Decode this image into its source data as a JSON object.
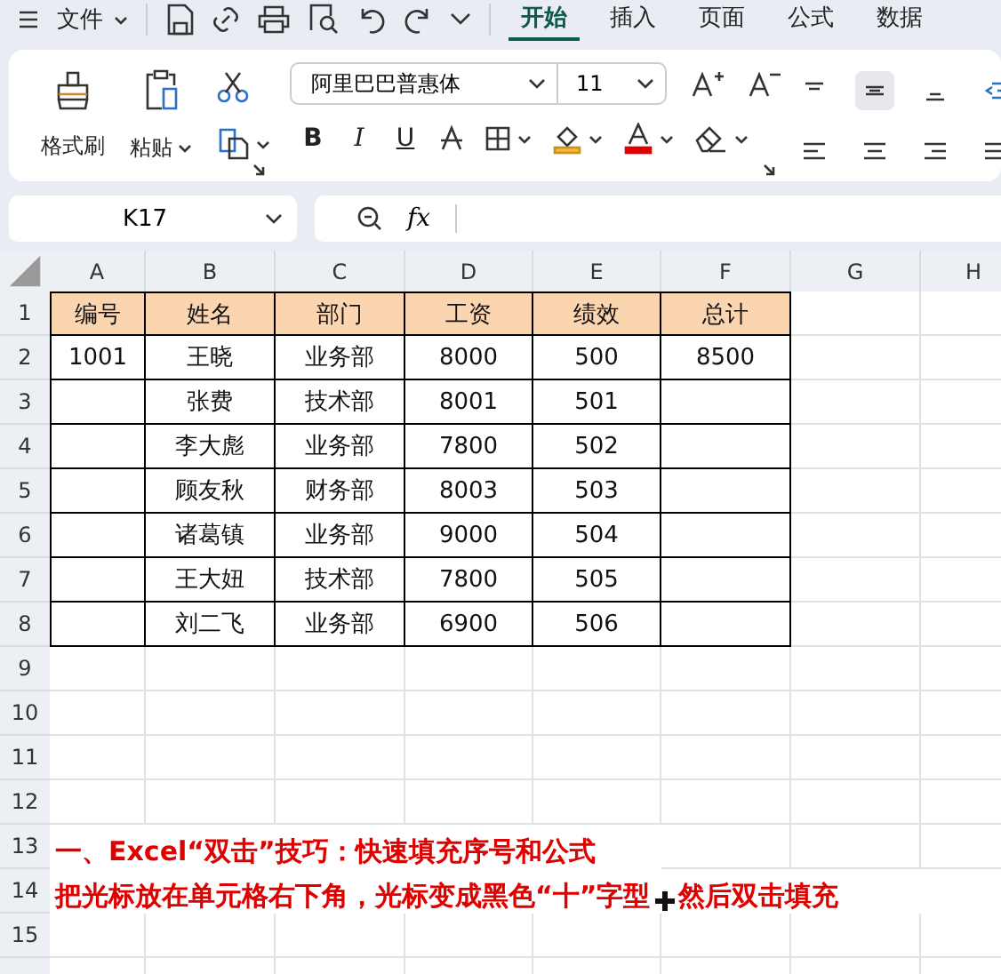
{
  "menu_bar": {
    "file_menu": "文件",
    "tabs": [
      {
        "label": "开始",
        "selected": true
      },
      {
        "label": "插入",
        "selected": false
      },
      {
        "label": "页面",
        "selected": false
      },
      {
        "label": "公式",
        "selected": false
      },
      {
        "label": "数据",
        "selected": false
      }
    ]
  },
  "ribbon": {
    "format_painter": "格式刷",
    "paste": "粘贴",
    "font_name": "阿里巴巴普惠体",
    "font_size": "11",
    "bold": "B",
    "italic": "I",
    "underline": "U"
  },
  "formula_bar": {
    "name_box": "K17",
    "fx": "fx"
  },
  "sheet": {
    "columns": [
      "A",
      "B",
      "C",
      "D",
      "E",
      "F",
      "G",
      "H"
    ],
    "rows": [
      {
        "number": "1",
        "header": true,
        "cells": [
          "编号",
          "姓名",
          "部门",
          "工资",
          "绩效",
          "总计"
        ]
      },
      {
        "number": "2",
        "header": false,
        "cells": [
          "1001",
          "王晓",
          "业务部",
          "8000",
          "500",
          "8500"
        ]
      },
      {
        "number": "3",
        "header": false,
        "cells": [
          null,
          "张费",
          "技术部",
          "8001",
          "501",
          null
        ]
      },
      {
        "number": "4",
        "header": false,
        "cells": [
          null,
          "李大彪",
          "业务部",
          "7800",
          "502",
          null
        ]
      },
      {
        "number": "5",
        "header": false,
        "cells": [
          null,
          "顾友秋",
          "财务部",
          "8003",
          "503",
          null
        ]
      },
      {
        "number": "6",
        "header": false,
        "cells": [
          null,
          "诸葛镇",
          "业务部",
          "9000",
          "504",
          null
        ]
      },
      {
        "number": "7",
        "header": false,
        "cells": [
          null,
          "王大妞",
          "技术部",
          "7800",
          "505",
          null
        ]
      },
      {
        "number": "8",
        "header": false,
        "cells": [
          null,
          "刘二飞",
          "业务部",
          "6900",
          "506",
          null
        ]
      },
      {
        "number": "9"
      },
      {
        "number": "10"
      },
      {
        "number": "11"
      },
      {
        "number": "12"
      },
      {
        "number": "13",
        "note": [
          "一、Excel“双击”技巧：快速填充序号和公式"
        ]
      },
      {
        "number": "14",
        "note": [
          "把光标放在单元格右下角，光标变成黑色“十”字型",
          "然后双击填充"
        ]
      },
      {
        "number": "15"
      }
    ]
  }
}
